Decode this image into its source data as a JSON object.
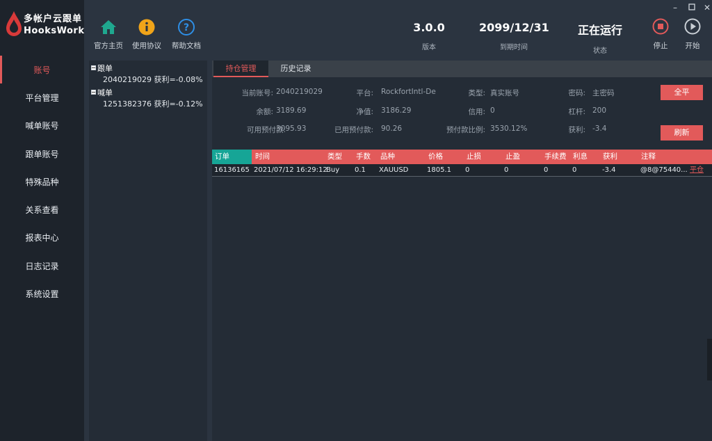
{
  "app": {
    "name_cn": "多帐户云跟单",
    "name_en": "HooksWork"
  },
  "header": {
    "buttons": [
      {
        "label": "官方主页",
        "icon": "home-icon"
      },
      {
        "label": "使用协议",
        "icon": "info-icon"
      },
      {
        "label": "帮助文档",
        "icon": "help-icon"
      }
    ],
    "version": {
      "value": "3.0.0",
      "label": "版本"
    },
    "expiry": {
      "value": "2099/12/31",
      "label": "到期时间"
    },
    "status": {
      "value": "正在运行",
      "label": "状态"
    },
    "stop_label": "停止",
    "start_label": "开始",
    "colors": {
      "accent": "#e25a5a",
      "home": "#1fa88f",
      "info": "#f0a419",
      "help": "#2e8fe6"
    }
  },
  "sidebar": {
    "items": [
      {
        "label": "账号",
        "active": true
      },
      {
        "label": "平台管理"
      },
      {
        "label": "喊单账号"
      },
      {
        "label": "跟单账号"
      },
      {
        "label": "特殊品种"
      },
      {
        "label": "关系查看"
      },
      {
        "label": "报表中心"
      },
      {
        "label": "日志记录"
      },
      {
        "label": "系统设置"
      }
    ]
  },
  "tree": {
    "groups": [
      {
        "label": "跟单",
        "children": [
          "2040219029 获利=-0.08%"
        ]
      },
      {
        "label": "喊单",
        "children": [
          "1251382376 获利=-0.12%"
        ]
      }
    ]
  },
  "tabs": [
    {
      "label": "持仓管理",
      "active": true
    },
    {
      "label": "历史记录"
    }
  ],
  "account": {
    "current_account": {
      "label": "当前账号:",
      "value": "2040219029"
    },
    "platform": {
      "label": "平台:",
      "value": "RockfortIntl-De"
    },
    "type": {
      "label": "类型:",
      "value": "真实账号"
    },
    "password": {
      "label": "密码:",
      "value": "主密码"
    },
    "balance": {
      "label": "余额:",
      "value": "3189.69"
    },
    "equity": {
      "label": "净值:",
      "value": "3186.29"
    },
    "credit": {
      "label": "信用:",
      "value": "0"
    },
    "leverage": {
      "label": "杠杆:",
      "value": "200"
    },
    "free_margin": {
      "label": "可用预付款:",
      "value": "3095.93"
    },
    "used_margin": {
      "label": "已用预付款:",
      "value": "90.26"
    },
    "margin_level": {
      "label": "预付款比例:",
      "value": "3530.12%"
    },
    "profit": {
      "label": "获利:",
      "value": "-3.4"
    },
    "close_all_label": "全平",
    "refresh_label": "刷新"
  },
  "table": {
    "columns": [
      "订单",
      "时间",
      "类型",
      "手数",
      "品种",
      "价格",
      "止损",
      "止盈",
      "手续费",
      "利息",
      "获利",
      "注释"
    ],
    "rows": [
      {
        "order": "16136165",
        "time": "2021/07/12 16:29:12",
        "type": "Buy",
        "lots": "0.1",
        "symbol": "XAUUSD",
        "price": "1805.1",
        "sl": "0",
        "tp": "0",
        "fee": "0",
        "swap": "0",
        "profit": "-3.4",
        "comment": "@8@75440...",
        "action": "平仓"
      }
    ]
  }
}
